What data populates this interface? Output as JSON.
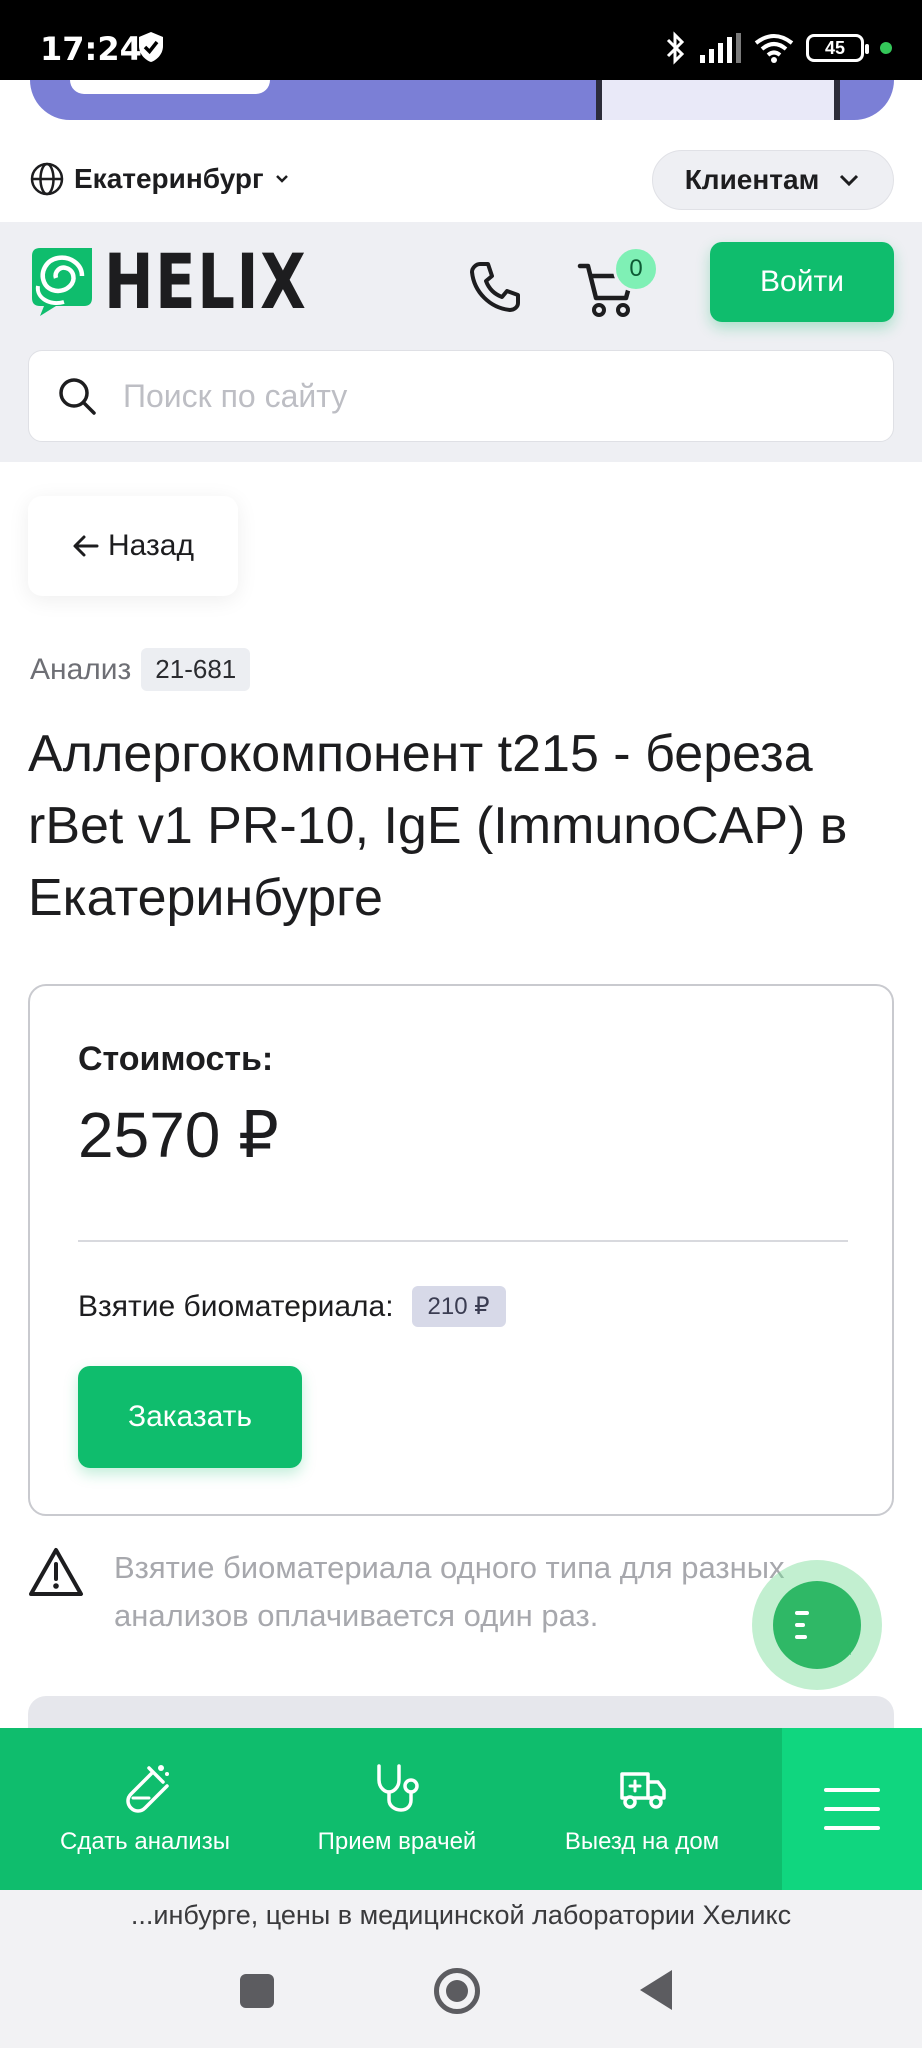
{
  "status_bar": {
    "time": "17:24",
    "battery": "45",
    "icons": [
      "shield-icon",
      "bluetooth-icon",
      "signal-icon",
      "wifi-icon",
      "battery-icon"
    ]
  },
  "location": {
    "city": "Екатеринбург",
    "clients_label": "Клиентам"
  },
  "header": {
    "logo_text": "HELIX",
    "cart_count": "0",
    "login_label": "Войти",
    "search_placeholder": "Поиск по сайту"
  },
  "back_label": "Назад",
  "analysis": {
    "label": "Анализ",
    "code": "21-681",
    "title": "Аллергокомпонент t215 - береза rBet v1 PR-10, IgE (ImmunoCAP) в Екатеринбурге"
  },
  "price_card": {
    "cost_label": "Стоимость:",
    "cost_value": "2570 ₽",
    "biomaterial_label": "Взятие биоматериала:",
    "biomaterial_price": "210 ₽",
    "order_label": "Заказать"
  },
  "notice": "Взятие биоматериала одного типа для разных анализов оплачивается один раз.",
  "bottom_nav": [
    {
      "label": "Сдать анализы",
      "icon": "test-tube-icon"
    },
    {
      "label": "Прием врачей",
      "icon": "stethoscope-icon"
    },
    {
      "label": "Выезд на дом",
      "icon": "delivery-truck-icon"
    }
  ],
  "url_strip": "...инбурге, цены в медицинской лаборатории Хеликс",
  "colors": {
    "brand_green": "#0fbd6d",
    "menu_green": "#10d67f",
    "badge_green": "#7ff0b5",
    "banner_purple": "#7b7fd6"
  }
}
